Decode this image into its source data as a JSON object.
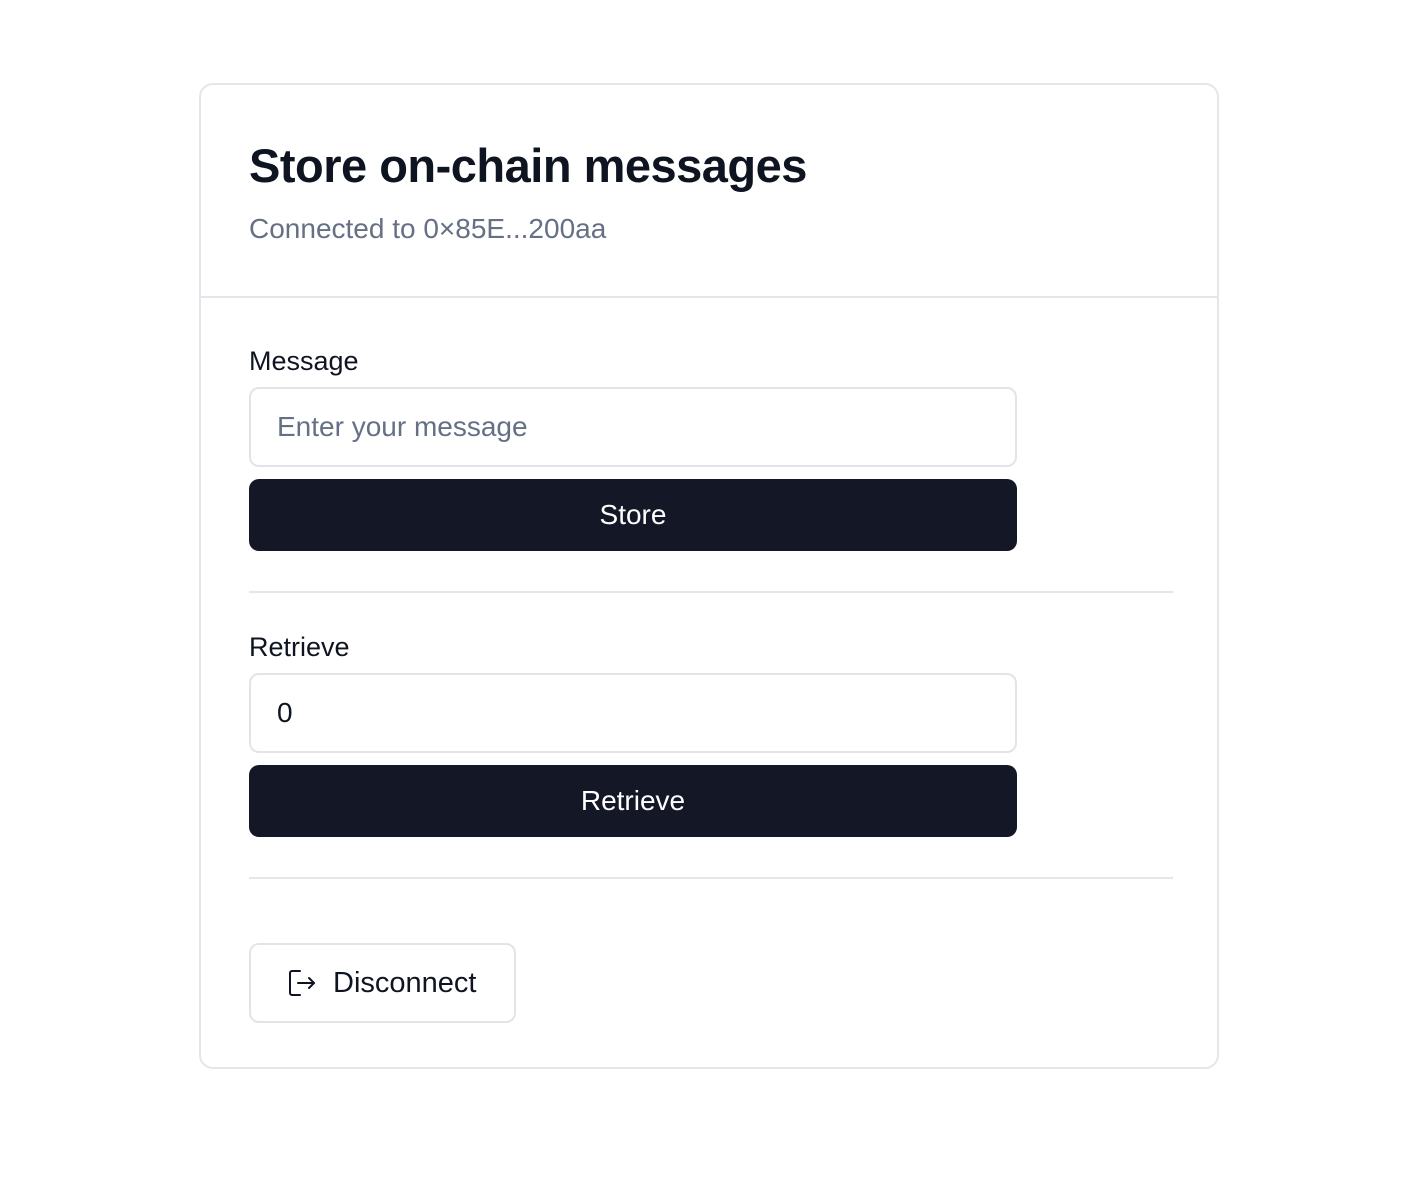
{
  "header": {
    "title": "Store on-chain messages",
    "subtitle": "Connected to 0×85E...200aa"
  },
  "message_section": {
    "label": "Message",
    "input_value": "",
    "input_placeholder": "Enter your message",
    "button_label": "Store"
  },
  "retrieve_section": {
    "label": "Retrieve",
    "input_value": "0",
    "button_label": "Retrieve"
  },
  "disconnect": {
    "label": "Disconnect",
    "icon": "logout-icon"
  },
  "colors": {
    "primary_button_bg": "#141826",
    "text_primary": "#0f1421",
    "text_muted": "#667085",
    "border": "#e4e6ec"
  }
}
